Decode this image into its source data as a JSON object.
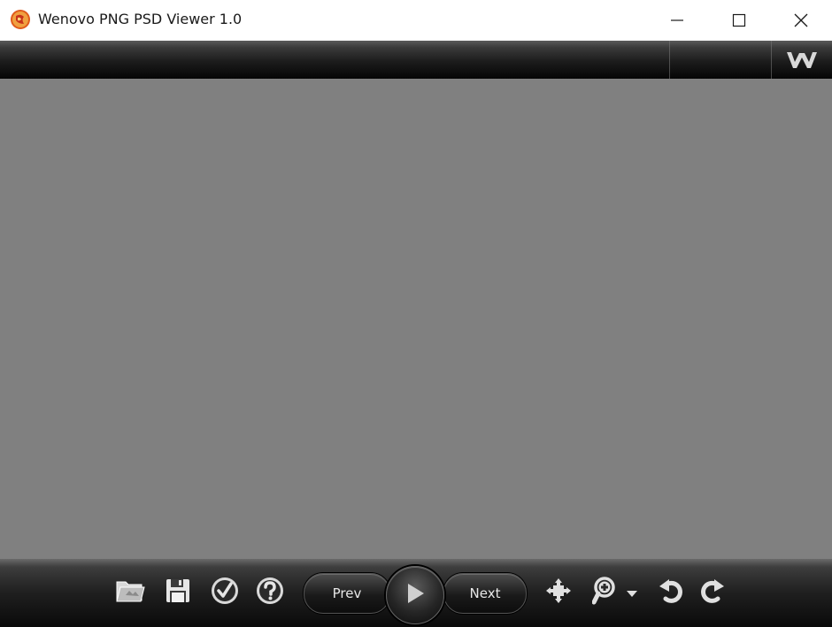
{
  "window": {
    "title": "Wenovo PNG PSD Viewer 1.0"
  },
  "titlebar_buttons": [
    "minimize-icon",
    "maximize-icon",
    "close-icon"
  ],
  "topbar": {
    "logo_text": "W"
  },
  "toolbar": {
    "prev_label": "Prev",
    "next_label": "Next",
    "icons": [
      "open-folder-icon",
      "save-icon",
      "check-icon",
      "help-icon",
      "play-icon",
      "fit-to-screen-icon",
      "zoom-icon",
      "rotate-left-icon",
      "rotate-right-icon"
    ]
  },
  "colors": {
    "canvas_background": "#808080",
    "toolbar_dark": "#1c1c1c",
    "icon_light": "#e6e6e6",
    "titlebar_background": "#ffffff"
  }
}
